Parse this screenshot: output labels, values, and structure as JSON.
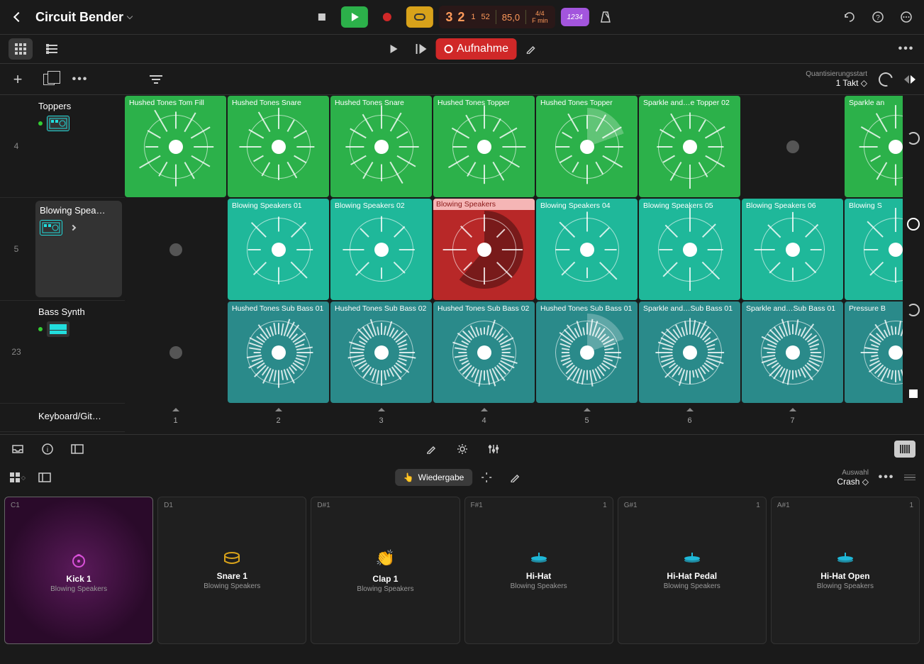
{
  "header": {
    "title": "Circuit Bender",
    "lcd": {
      "bars": "3 2",
      "beat": "1",
      "sub": "52",
      "tempo": "85,0",
      "sig_top": "4/4",
      "sig_bot": "F min"
    },
    "count": "1234"
  },
  "toolbar2": {
    "record_label": "Aufnahme"
  },
  "toolbar3": {
    "quant_label": "Quantisierungsstart",
    "quant_value": "1 Takt"
  },
  "tracks": [
    {
      "num": "4",
      "name": "Toppers"
    },
    {
      "num": "5",
      "name": "Blowing Spea…"
    },
    {
      "num": "23",
      "name": "Bass Synth"
    },
    {
      "num": "",
      "name": "Keyboard/Git…"
    }
  ],
  "rows": [
    {
      "color": "green",
      "cells": [
        {
          "label": "Hushed Tones Tom Fill"
        },
        {
          "label": "Hushed Tones Snare"
        },
        {
          "label": "Hushed Tones Snare"
        },
        {
          "label": "Hushed Tones Topper"
        },
        {
          "label": "Hushed Tones Topper",
          "progress": true
        },
        {
          "label": "Sparkle and…e Topper 02"
        },
        {
          "label": "",
          "empty": true
        },
        {
          "label": "Sparkle an"
        }
      ]
    },
    {
      "color": "teal",
      "cells": [
        {
          "label": "",
          "empty": true
        },
        {
          "label": "Blowing Speakers 01"
        },
        {
          "label": "Blowing Speakers 02"
        },
        {
          "label": "Blowing Speakers",
          "red": true,
          "progress": true
        },
        {
          "label": "Blowing Speakers 04"
        },
        {
          "label": "Blowing Speakers 05"
        },
        {
          "label": "Blowing Speakers 06"
        },
        {
          "label": "Blowing S"
        }
      ]
    },
    {
      "color": "darkteal",
      "cells": [
        {
          "label": "",
          "empty": true
        },
        {
          "label": "Hushed Tones Sub Bass 01"
        },
        {
          "label": "Hushed Tones Sub Bass 02"
        },
        {
          "label": "Hushed Tones Sub Bass 02"
        },
        {
          "label": "Hushed Tones Sub Bass 01",
          "progress": true
        },
        {
          "label": "Sparkle and…Sub Bass 01"
        },
        {
          "label": "Sparkle and…Sub Bass 01"
        },
        {
          "label": "Pressure B"
        }
      ]
    }
  ],
  "scenes": [
    "1",
    "2",
    "3",
    "4",
    "5",
    "6",
    "7"
  ],
  "pads_toolbar": {
    "play_label": "Wiedergabe",
    "selection_label": "Auswahl",
    "selection_value": "Crash"
  },
  "pads": [
    {
      "note": "C1",
      "num": "",
      "name": "Kick 1",
      "kit": "Blowing Speakers",
      "active": true,
      "icon": "kick"
    },
    {
      "note": "D1",
      "num": "",
      "name": "Snare 1",
      "kit": "Blowing Speakers",
      "icon": "drum"
    },
    {
      "note": "D#1",
      "num": "",
      "name": "Clap 1",
      "kit": "Blowing Speakers",
      "icon": "clap"
    },
    {
      "note": "F#1",
      "num": "1",
      "name": "Hi-Hat",
      "kit": "Blowing Speakers",
      "icon": "hihat"
    },
    {
      "note": "G#1",
      "num": "1",
      "name": "Hi-Hat Pedal",
      "kit": "Blowing Speakers",
      "icon": "hihat"
    },
    {
      "note": "A#1",
      "num": "1",
      "name": "Hi-Hat Open",
      "kit": "Blowing Speakers",
      "icon": "hihat"
    }
  ]
}
